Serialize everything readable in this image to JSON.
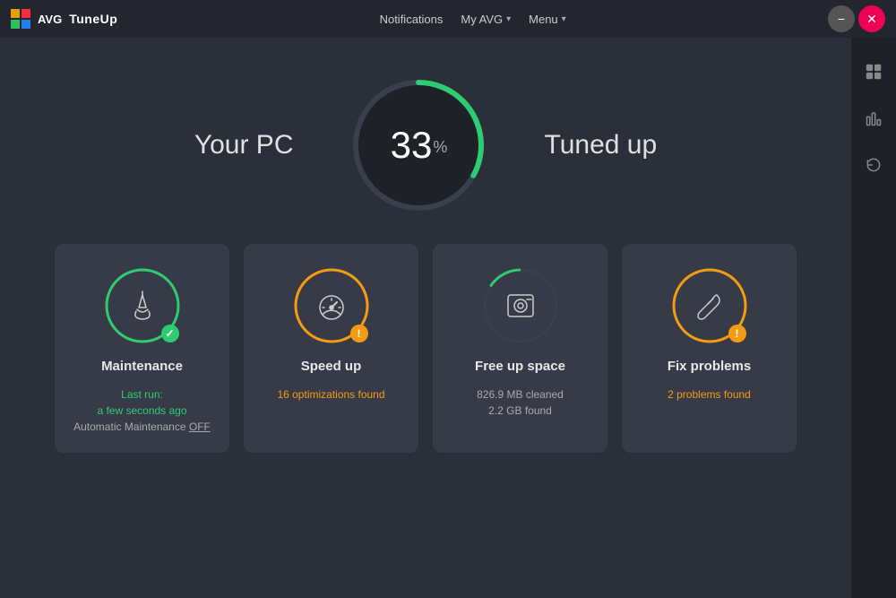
{
  "titlebar": {
    "app_name": "TuneUp",
    "brand": "AVG",
    "notifications_label": "Notifications",
    "myavg_label": "My AVG",
    "menu_label": "Menu",
    "minimize_label": "−",
    "close_label": "✕"
  },
  "hero": {
    "left_text": "Your PC",
    "right_text": "Tuned up",
    "percent": "33",
    "percent_symbol": "%"
  },
  "sidebar": {
    "icons": [
      "grid",
      "bar-chart",
      "refresh"
    ]
  },
  "cards": [
    {
      "id": "maintenance",
      "title": "Maintenance",
      "ring_color": "#2ecc71",
      "badge_type": "green",
      "badge_symbol": "✓",
      "sub_line1": "Last run:",
      "sub_line1_class": "highlight-green",
      "sub_line2": "a few seconds ago",
      "sub_line2_class": "highlight-green",
      "sub_line3": "Automatic Maintenance ",
      "sub_line3_suffix": "OFF",
      "sub_line3_class": "",
      "sub_line3_suffix_class": "underline"
    },
    {
      "id": "speed-up",
      "title": "Speed up",
      "ring_color": "#f39c12",
      "badge_type": "orange",
      "badge_symbol": "!",
      "sub_line1": "16 optimizations found",
      "sub_line1_class": "highlight-orange",
      "sub_line2": "",
      "sub_line2_class": "",
      "sub_line3": "",
      "sub_line3_suffix": "",
      "sub_line3_class": "",
      "sub_line3_suffix_class": ""
    },
    {
      "id": "free-space",
      "title": "Free up space",
      "ring_color": "#3d4455",
      "ring_color_accent": "#2ecc71",
      "badge_type": null,
      "badge_symbol": "",
      "sub_line1": "826.9 MB cleaned",
      "sub_line1_class": "",
      "sub_line2": "2.2 GB found",
      "sub_line2_class": "",
      "sub_line3": "",
      "sub_line3_suffix": "",
      "sub_line3_class": "",
      "sub_line3_suffix_class": ""
    },
    {
      "id": "fix-problems",
      "title": "Fix problems",
      "ring_color": "#f39c12",
      "badge_type": "orange",
      "badge_symbol": "!",
      "sub_line1": "2 problems found",
      "sub_line1_class": "highlight-orange",
      "sub_line2": "",
      "sub_line2_class": "",
      "sub_line3": "",
      "sub_line3_suffix": "",
      "sub_line3_class": "",
      "sub_line3_suffix_class": ""
    }
  ]
}
